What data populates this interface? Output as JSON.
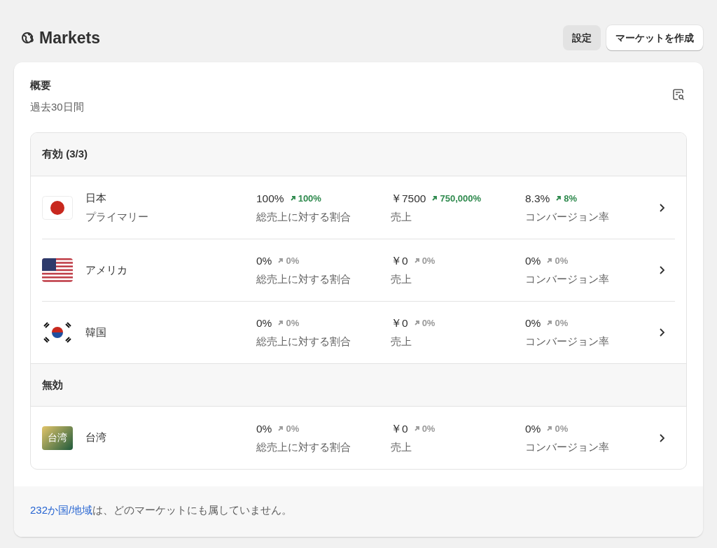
{
  "page_title": "Markets",
  "header_buttons": [
    {
      "label": "設定",
      "kind": "secondary"
    },
    {
      "label": "マーケットを作成",
      "kind": "primary"
    }
  ],
  "overview": {
    "title": "概要",
    "period": "過去30日間"
  },
  "groups": [
    {
      "title": "有効 (3/3)",
      "markets": [
        {
          "name": "日本",
          "subtitle": "プライマリー",
          "kind": "japan",
          "metrics": [
            {
              "value": "100%",
              "change": "100%",
              "positive": true,
              "label": "総売上に対する割合"
            },
            {
              "value": "￥7500",
              "change": "750,000%",
              "positive": true,
              "label": "売上"
            },
            {
              "value": "8.3%",
              "change": "8%",
              "positive": true,
              "label": "コンバージョン率"
            }
          ]
        },
        {
          "name": "アメリカ",
          "kind": "usa",
          "metrics": [
            {
              "value": "0%",
              "change": "0%",
              "positive": false,
              "label": "総売上に対する割合"
            },
            {
              "value": "￥0",
              "change": "0%",
              "positive": false,
              "label": "売上"
            },
            {
              "value": "0%",
              "change": "0%",
              "positive": false,
              "label": "コンバージョン率"
            }
          ]
        },
        {
          "name": "韓国",
          "kind": "korea",
          "metrics": [
            {
              "value": "0%",
              "change": "0%",
              "positive": false,
              "label": "総売上に対する割合"
            },
            {
              "value": "￥0",
              "change": "0%",
              "positive": false,
              "label": "売上"
            },
            {
              "value": "0%",
              "change": "0%",
              "positive": false,
              "label": "コンバージョン率"
            }
          ]
        }
      ]
    },
    {
      "title": "無効",
      "markets": [
        {
          "name": "台湾",
          "kind": "text",
          "flag_text": "台湾",
          "metrics": [
            {
              "value": "0%",
              "change": "0%",
              "positive": false,
              "label": "総売上に対する割合"
            },
            {
              "value": "￥0",
              "change": "0%",
              "positive": false,
              "label": "売上"
            },
            {
              "value": "0%",
              "change": "0%",
              "positive": false,
              "label": "コンバージョン率"
            }
          ]
        }
      ]
    }
  ],
  "footer": {
    "link": "232か国/地域",
    "text": "は、どのマーケットにも属していません。"
  }
}
